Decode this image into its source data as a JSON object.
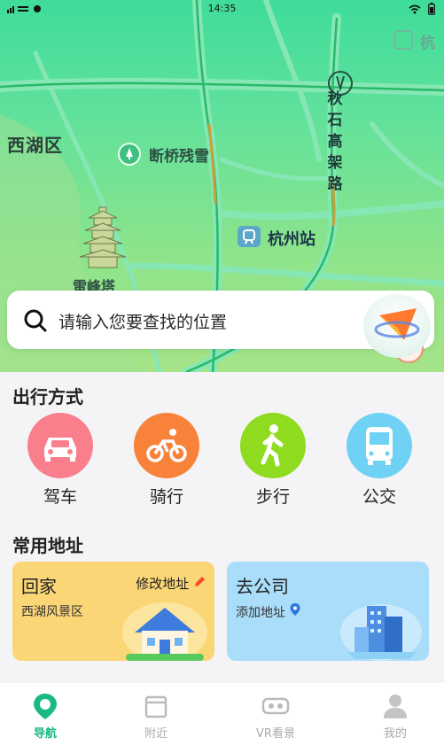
{
  "status_bar": {
    "time": "14:35"
  },
  "map": {
    "labels": {
      "district": "西湖区",
      "scenic_spot": "断桥残雪",
      "station": "杭州站",
      "pagoda": "雷峰塔",
      "road": "秋石高架路",
      "corner": "杭"
    },
    "traffic_color": "#c9a03a"
  },
  "search": {
    "placeholder": "请输入您要查找的位置",
    "icon": "search-icon"
  },
  "travel_modes": {
    "title": "出行方式",
    "items": [
      {
        "label": "驾车",
        "icon": "car-icon",
        "color": "#f97f8d"
      },
      {
        "label": "骑行",
        "icon": "bicycle-icon",
        "color": "#f8823a"
      },
      {
        "label": "步行",
        "icon": "walk-icon",
        "color": "#8edb1f"
      },
      {
        "label": "公交",
        "icon": "bus-icon",
        "color": "#6fd1f4"
      }
    ]
  },
  "addresses": {
    "title": "常用地址",
    "home": {
      "title": "回家",
      "subtitle": "西湖风景区",
      "action": "修改地址",
      "color": "#fbd677"
    },
    "office": {
      "title": "去公司",
      "subtitle": "添加地址",
      "color": "#a9ddf9"
    }
  },
  "tabbar": {
    "active_color": "#19b980",
    "items": [
      {
        "label": "导航",
        "icon": "location-pin-icon",
        "active": true
      },
      {
        "label": "附近",
        "icon": "store-icon",
        "active": false
      },
      {
        "label": "VR看景",
        "icon": "vr-headset-icon",
        "active": false
      },
      {
        "label": "我的",
        "icon": "user-icon",
        "active": false
      }
    ]
  }
}
